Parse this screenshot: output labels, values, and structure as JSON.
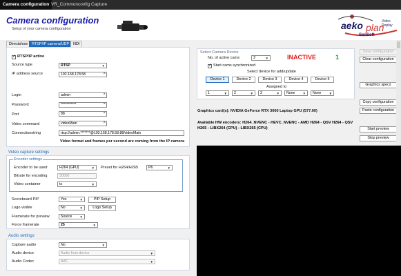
{
  "tabs_top": [
    "Camera configuration",
    "VR_Commonconfig",
    "Capture"
  ],
  "header": {
    "title": "Camera configuration",
    "subtitle": "Setup of your camera configuration"
  },
  "logo": {
    "brand": "aeko",
    "brand2": "plan",
    "line1": "Video Replay",
    "line2": "SenSoft"
  },
  "source_tabs": [
    "Directshow",
    "RTSP/IP camera/UDP",
    "NDI"
  ],
  "rtsp": {
    "active_label": "RTSP/IP active",
    "source_type_label": "Source type",
    "source_type": "RTSP",
    "ip_label": "IP address source",
    "ip": "192.168.178.58",
    "login_label": "Login",
    "login": "admin",
    "password_label": "Password",
    "password": "***********",
    "port_label": "Port",
    "port": "88",
    "video_command_label": "Video command",
    "video_command": "videoMain",
    "connstring_label": "Connectionstring",
    "connstring": "rtsp://admin:*******@192.168.178.58:88/videoMain",
    "note": "Video format and frames per second are coming from the IP camera"
  },
  "video_capture": {
    "title": "Video capture settings",
    "encoder_title": "Encoder settings",
    "encoder_label": "Encoder to be used",
    "encoder": "H264 (GPU)",
    "preset_label": "Preset for H264/H265",
    "preset": "P6",
    "bitrate_label": "Bitrate for encoding",
    "bitrate": "30000",
    "container_label": "Video container",
    "container": "ts",
    "scoreboard_label": "Scoreboard PIP",
    "scoreboard": "Yes",
    "pip_setup": "PIP Setup",
    "logo_label": "Logo visible",
    "logo": "No",
    "logo_setup": "Logo Setup",
    "framerate_preview_label": "Framerate for preview",
    "framerate_preview": "Source",
    "force_framerate_label": "Force framerate",
    "force_framerate": "25"
  },
  "audio": {
    "title": "Audio settings",
    "capture_label": "Capture audio",
    "capture": "No",
    "device_label": "Audio device",
    "device": "Audio from device",
    "codec_label": "Audio Codec",
    "codec": "AAC"
  },
  "select_device": {
    "title": "Select Camera Device",
    "active_cams_label": "No. of active cams",
    "active_cams": "3",
    "status": "INACTIVE",
    "status_num": "1",
    "sync_label": "Start cams synchronized",
    "select_label": "Select device for add/update",
    "devices": [
      "Device 1",
      "Device 2",
      "Device 3",
      "Device 4",
      "Device 5"
    ],
    "assigned_label": "Assigned to",
    "assigned": [
      "1",
      "2",
      "3",
      "None",
      "None"
    ]
  },
  "gpu_text": "Graphics card(s): NVIDIA GeForce RTX 3060 Laptop GPU (577.00)",
  "encoders_text": "Available HW encoders: H264_NVENC - HEVC_NVENC - AMD H264 - QSV H264 - QSV H265 - LIBX264 (CPU) - LIBX265 (CPU)",
  "right_buttons": {
    "save": "Save configuration",
    "clear": "Clear configuration",
    "graphics": "Graphics specs",
    "copy": "Copy configuration",
    "paste": "Paste configuration",
    "start": "Start preview",
    "stop": "Stop preview"
  },
  "colors": {
    "accent": "#1e6bbf",
    "inactive": "#e02020",
    "status_num": "#1a9a1a",
    "title": "#1a1aa8"
  }
}
